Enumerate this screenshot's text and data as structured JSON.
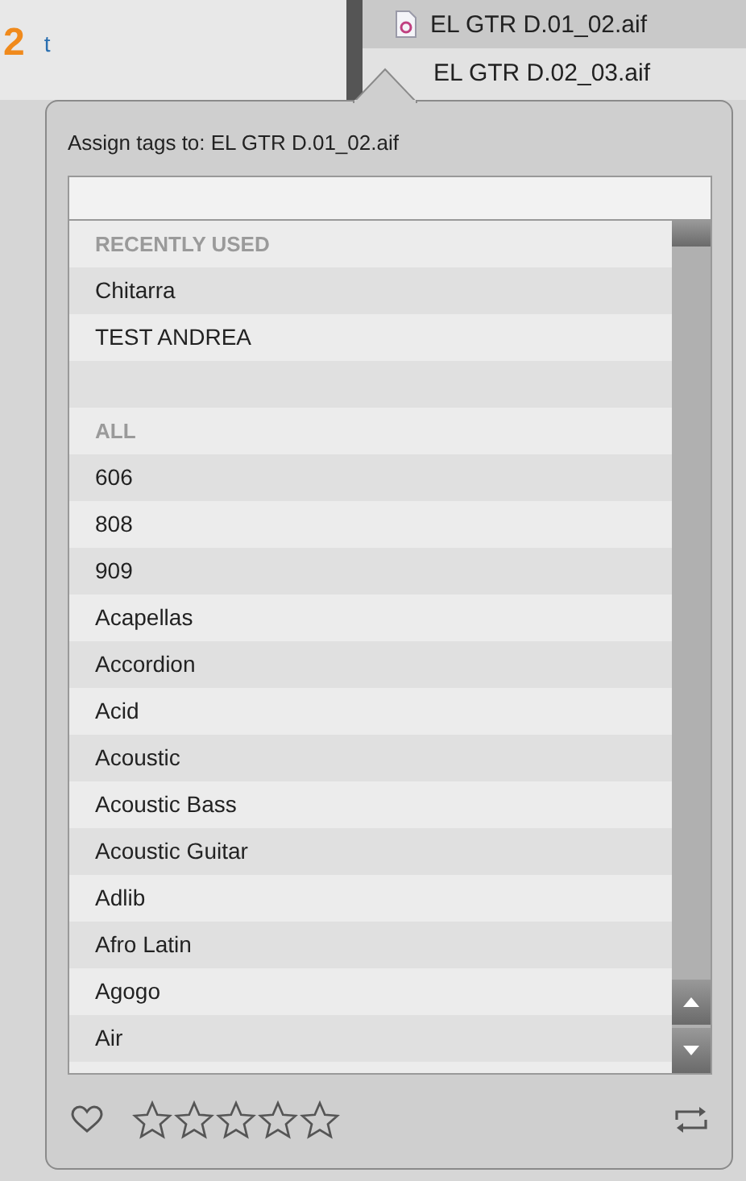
{
  "background": {
    "marker": "2",
    "fragment": "t"
  },
  "files": [
    {
      "name": "EL GTR D.01_02.aif",
      "selected": true
    },
    {
      "name": "EL GTR D.02_03.aif",
      "selected": false
    }
  ],
  "popover": {
    "title": "Assign tags to: EL GTR D.01_02.aif",
    "tags": [
      {
        "kind": "header",
        "label": "RECENTLY USED"
      },
      {
        "kind": "item",
        "label": "Chitarra"
      },
      {
        "kind": "item",
        "label": "TEST ANDREA"
      },
      {
        "kind": "spacer"
      },
      {
        "kind": "header",
        "label": "ALL"
      },
      {
        "kind": "item",
        "label": "606"
      },
      {
        "kind": "item",
        "label": "808"
      },
      {
        "kind": "item",
        "label": "909"
      },
      {
        "kind": "item",
        "label": "Acapellas"
      },
      {
        "kind": "item",
        "label": "Accordion"
      },
      {
        "kind": "item",
        "label": "Acid"
      },
      {
        "kind": "item",
        "label": "Acoustic"
      },
      {
        "kind": "item",
        "label": "Acoustic Bass"
      },
      {
        "kind": "item",
        "label": "Acoustic Guitar"
      },
      {
        "kind": "item",
        "label": "Adlib"
      },
      {
        "kind": "item",
        "label": "Afro Latin"
      },
      {
        "kind": "item",
        "label": "Agogo"
      },
      {
        "kind": "item",
        "label": "Air"
      }
    ],
    "favorite": false,
    "stars": 0
  }
}
